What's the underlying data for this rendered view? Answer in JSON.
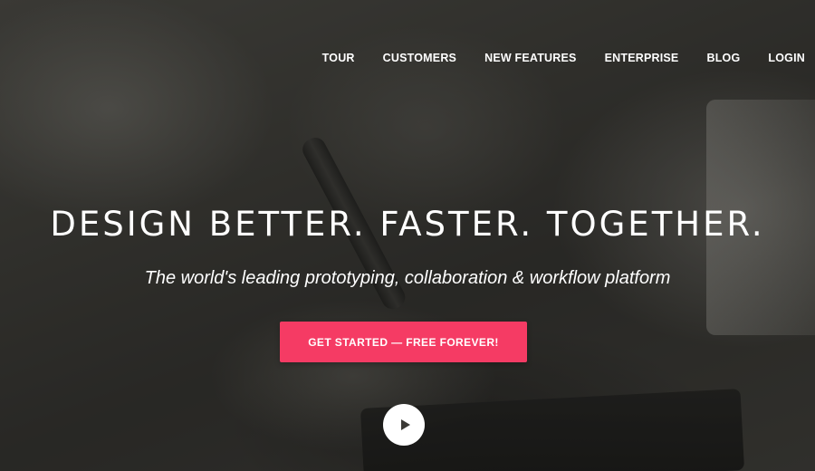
{
  "nav": {
    "items": [
      {
        "label": "TOUR"
      },
      {
        "label": "CUSTOMERS"
      },
      {
        "label": "NEW FEATURES"
      },
      {
        "label": "ENTERPRISE"
      },
      {
        "label": "BLOG"
      },
      {
        "label": "LOGIN"
      }
    ]
  },
  "hero": {
    "headline": "DESIGN BETTER. FASTER. TOGETHER.",
    "subhead": "The world's leading prototyping, collaboration & workflow platform",
    "cta_label": "GET STARTED — FREE FOREVER!",
    "play_icon": "play-icon"
  },
  "colors": {
    "cta_background": "#f53b64",
    "text": "#ffffff",
    "play_button": "#ffffff",
    "play_glyph": "#3a3935"
  }
}
